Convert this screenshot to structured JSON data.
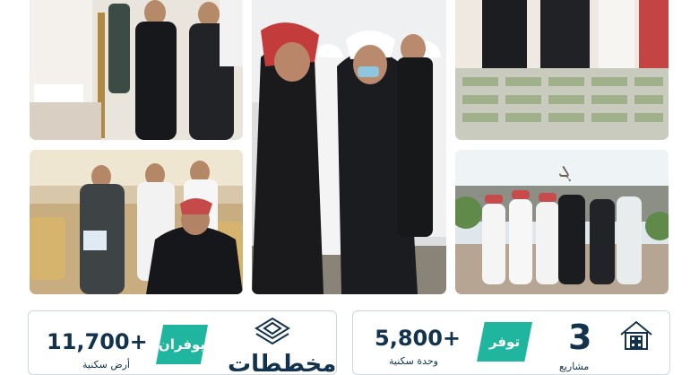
{
  "stats_left": {
    "count": "11,700+",
    "count_label": "أرض سكنية",
    "tag": "يوفران",
    "heading": "مخططات",
    "icon": "map-plan-icon"
  },
  "stats_right": {
    "count": "5,800+",
    "count_label": "وحدة سكنية",
    "tag": "توفر",
    "number": "3",
    "number_label": "مشاريع",
    "icon": "house-icon"
  },
  "colors": {
    "navy": "#12324d",
    "teal": "#1fb59f",
    "border": "#cfd6dc"
  },
  "photos": [
    {
      "name": "photo-exhibition-visit"
    },
    {
      "name": "photo-officials-discussion"
    },
    {
      "name": "photo-master-plan-model"
    },
    {
      "name": "photo-meeting-room"
    },
    {
      "name": "photo-site-walk"
    }
  ]
}
